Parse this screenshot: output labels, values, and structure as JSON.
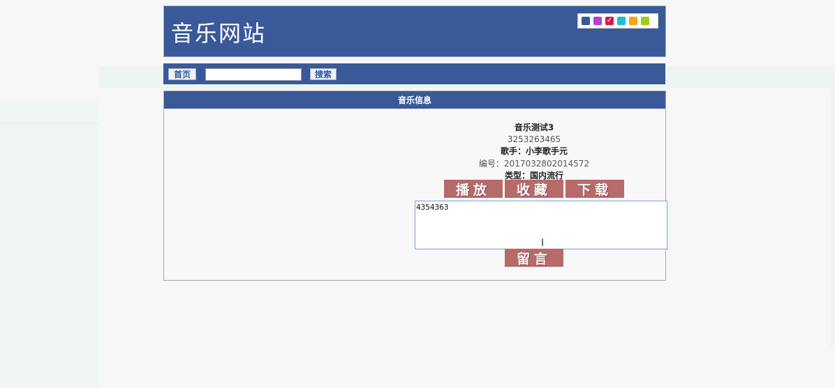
{
  "header": {
    "site_title": "音乐网站",
    "theme_swatches": [
      {
        "name": "navy",
        "color": "#3a5998"
      },
      {
        "name": "purple",
        "color": "#b440d6"
      },
      {
        "name": "crimson",
        "color": "#d8174f",
        "selected": true
      },
      {
        "name": "teal",
        "color": "#1ebfd0"
      },
      {
        "name": "orange",
        "color": "#f6a51a"
      },
      {
        "name": "lime",
        "color": "#a3c91b"
      }
    ]
  },
  "nav": {
    "home_label": "首页",
    "search_value": "",
    "search_label": "搜索"
  },
  "panel": {
    "title": "音乐信息"
  },
  "music": {
    "name": "音乐测试3",
    "description": "3253263465",
    "singer_label": "歌手：",
    "singer": "小李歌手元",
    "code_label": "编号：",
    "code": "2017032802014572",
    "type_label": "类型：",
    "type": "国内流行"
  },
  "actions": {
    "play_label": "播放",
    "collect_label": "收藏",
    "download_label": "下载",
    "comment_value": "4354363",
    "leave_message_label": "留言"
  },
  "colors": {
    "primary": "#3a5998",
    "button": "#b76a6a"
  }
}
